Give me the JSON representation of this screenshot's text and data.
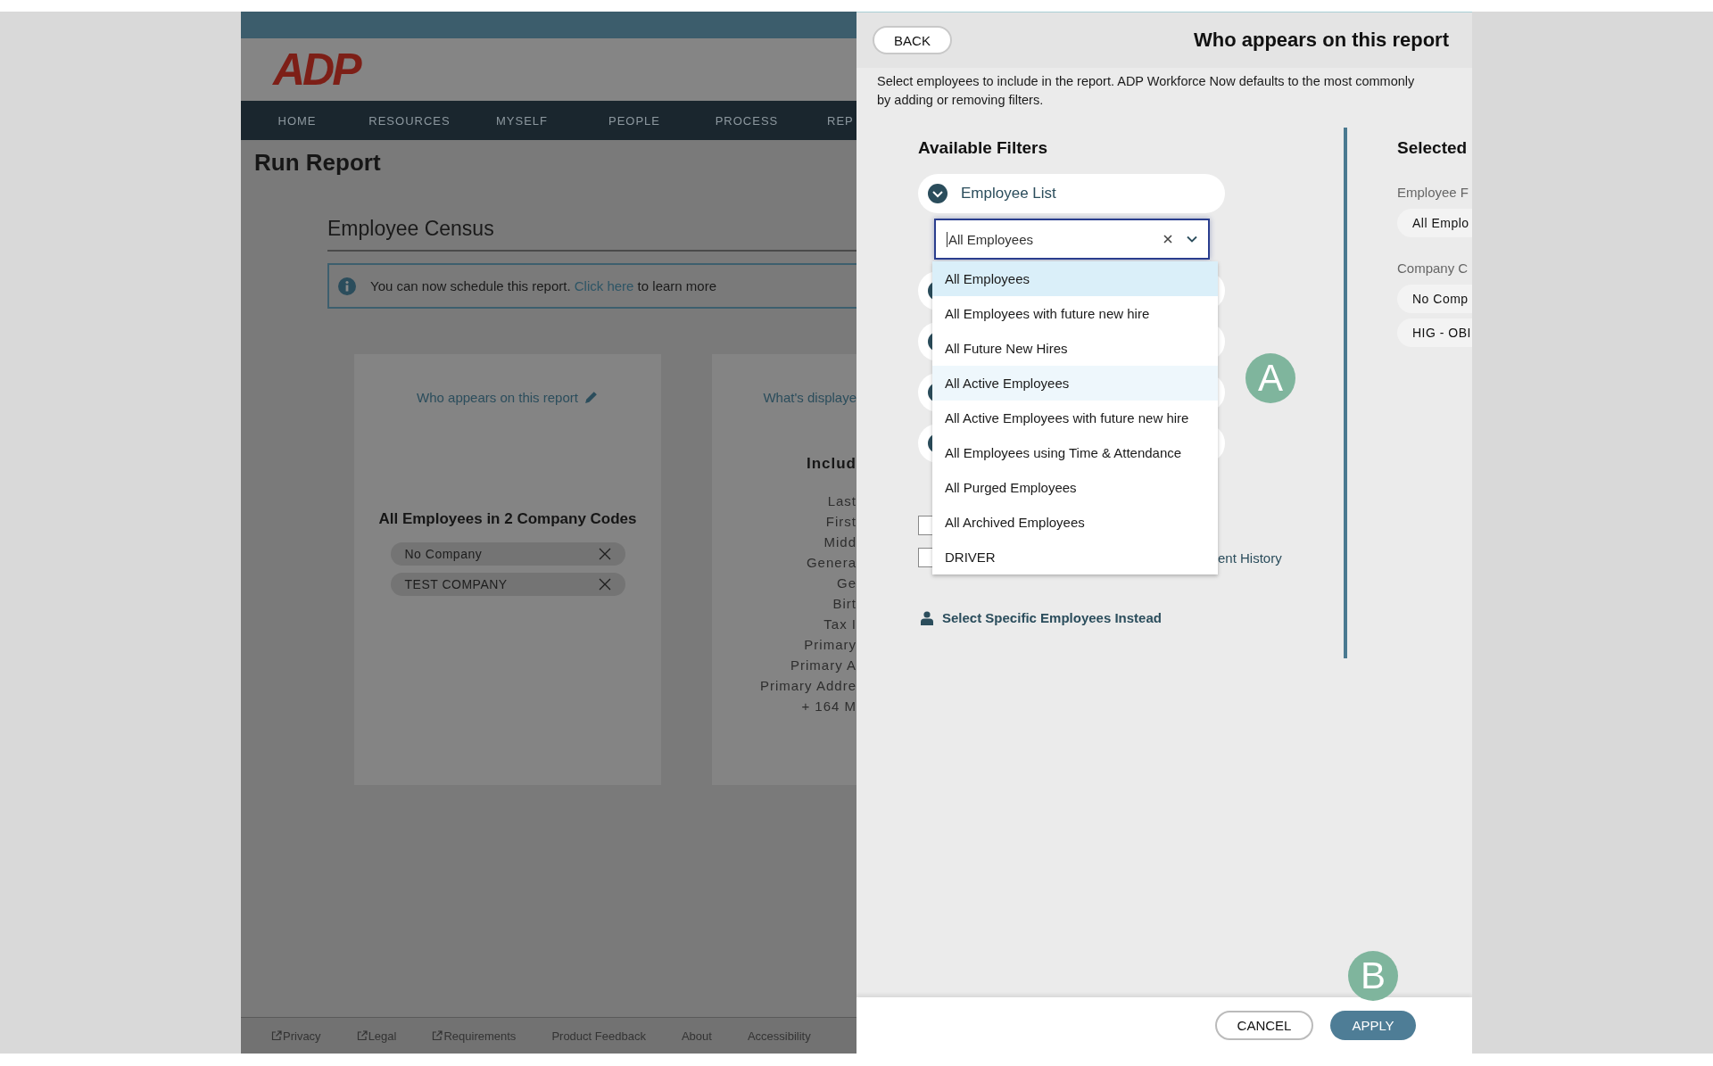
{
  "app": {
    "logo": "ADP",
    "nav": [
      "HOME",
      "RESOURCES",
      "MYSELF",
      "PEOPLE",
      "PROCESS",
      "REP"
    ],
    "page_title": "Run Report",
    "report_title": "Employee Census",
    "notice": {
      "text": "You can now schedule this report.",
      "link": "Click here",
      "suffix": "to learn more"
    },
    "who_card": {
      "link": "Who appears on this report",
      "heading": "All Employees in 2 Company Codes",
      "chips": [
        "No Company",
        "TEST COMPANY"
      ]
    },
    "display_card": {
      "link": "What's displaye",
      "heading": "Includ",
      "fields": [
        "Last",
        "First",
        "Midd",
        "Genera",
        "Ge",
        "Birt",
        "Tax I",
        "Primary",
        "Primary A",
        "Primary Addre",
        "+ 164 M"
      ]
    },
    "footer_links": [
      {
        "label": "Privacy",
        "external": true
      },
      {
        "label": "Legal",
        "external": true
      },
      {
        "label": "Requirements",
        "external": true
      },
      {
        "label": "Product Feedback",
        "external": false
      },
      {
        "label": "About",
        "external": false
      },
      {
        "label": "Accessibility",
        "external": false
      }
    ]
  },
  "panel": {
    "back_button": "BACK",
    "title": "Who appears on this report",
    "description": [
      "Select employees to include in the report. ADP Workforce Now defaults to the most commonly",
      "by adding or removing filters."
    ],
    "available": {
      "heading": "Available Filters",
      "filter": {
        "label": "Employee List",
        "expanded": true
      },
      "select": {
        "value": "All Employees",
        "open": true,
        "options": [
          {
            "label": "All Employees",
            "selected": true,
            "highlighted": false
          },
          {
            "label": "All Employees with future new hire",
            "selected": false,
            "highlighted": false
          },
          {
            "label": "All Future New Hires",
            "selected": false,
            "highlighted": false
          },
          {
            "label": "All Active Employees",
            "selected": false,
            "highlighted": true
          },
          {
            "label": "All Active Employees with future new hire",
            "selected": false,
            "highlighted": false
          },
          {
            "label": "All Employees using Time & Attendance",
            "selected": false,
            "highlighted": false
          },
          {
            "label": "All Purged Employees",
            "selected": false,
            "highlighted": false
          },
          {
            "label": "All Archived Employees",
            "selected": false,
            "highlighted": false
          },
          {
            "label": "DRIVER",
            "selected": false,
            "highlighted": false
          }
        ]
      },
      "checkboxes": [
        {
          "checked": false
        },
        {
          "checked": false,
          "label": "ent History"
        }
      ],
      "specific_link": "Select Specific Employees Instead"
    },
    "selected": {
      "heading": "Selected",
      "groups": [
        {
          "label": "Employee F",
          "chips": [
            "All Emplo"
          ]
        },
        {
          "label": "Company C",
          "chips": [
            "No Comp",
            "HIG - OBI"
          ]
        }
      ]
    },
    "cancel_button": "CANCEL",
    "apply_button": "APPLY"
  },
  "markers": [
    {
      "label": "A"
    },
    {
      "label": "B"
    }
  ]
}
